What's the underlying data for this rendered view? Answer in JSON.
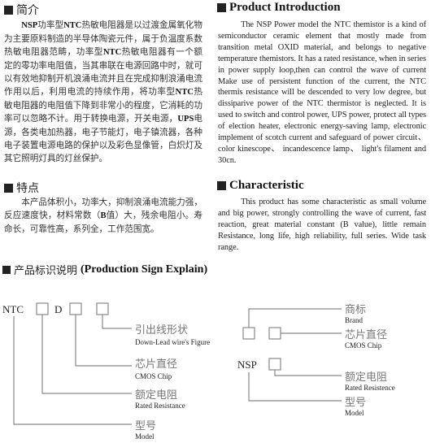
{
  "intro_cn": {
    "heading": "简介",
    "parts": [
      {
        "t": "NSP",
        "b": true
      },
      {
        "t": "功率型",
        "b": false
      },
      {
        "t": "NTC",
        "b": true
      },
      {
        "t": "热敏电阻器是以过渡金属氧化物为主要原料制造的半导体陶瓷元件，属于负温度系数热敏电阻器范畴，功率型",
        "b": false
      },
      {
        "t": "NTC",
        "b": true
      },
      {
        "t": "热敏电阻器有一个额定的零功率电阻值，当其串联在电源回路中时，就可以有效地抑制开机浪涌电流并且在完成抑制浪涌电流作用以后，利用电流的持续作用，将功率型",
        "b": false
      },
      {
        "t": "NTC",
        "b": true
      },
      {
        "t": "热敏电阻器的电阻值下降到非常小的程度，它消耗的功率可以忽略不计。用于转换电源，开关电源，",
        "b": false
      },
      {
        "t": "UPS",
        "b": true
      },
      {
        "t": "电源，各类电加热器，电子节能灯，电子镇流器，各种电子装置电源电路的保护以及彩色显像管，白炽灯及其它照明灯具的灯丝保护。",
        "b": false
      }
    ]
  },
  "intro_en": {
    "heading": "Product Introduction",
    "text": "The NSP Power model the NTC themistor is a kind of semiconductor ceramic element that mostly made from transition metal OXID material, and belongs to negative temperature themistors. It has a rated resistance, when in series in power supply loop,then can control the wave of current Make use of persistent function of the current, the NTC thermis resistance will be descended to very low degree, but dissiparive power of the NTC thermistor is neglected. It is used to switch and control power, UPS power, protect all types of election heater, electronic energy-saving lamp, electronic implement of scotch current and safeguard of power circuit、 color kinescope、 incandescence lamp、 light's filament and 30cn."
  },
  "features_cn": {
    "heading": "特点",
    "parts": [
      {
        "t": "本产品体积小，功率大，抑制浪涌电流能力强，反应速度快，材料常数（",
        "b": false
      },
      {
        "t": "B",
        "b": true
      },
      {
        "t": "值）大，残余电阻小。寿命长，可靠性高，系列全，工作范围宽。",
        "b": false
      }
    ]
  },
  "features_en": {
    "heading": "Characteristic",
    "text": "This product has some characteristic as small volume and big power, strongly controlling the wave of current, fast reaction, great material constant (B value), little remain Resistance, long life, high reliability, full series. Wide task range."
  },
  "sign_explain": {
    "heading_cn": "产品标识说明",
    "heading_en": "(Production Sign Explain)",
    "ntc": {
      "prefix": "NTC",
      "middle": "D",
      "labels": [
        {
          "cn": "引出线形状",
          "en": "Down-Lead wire's Figure"
        },
        {
          "cn": "芯片直径",
          "en": "CMOS Chip"
        },
        {
          "cn": "额定电阻",
          "en": "Rated Resistance"
        },
        {
          "cn": "型号",
          "en": "Model"
        }
      ]
    },
    "nsp": {
      "prefix": "NSP",
      "labels": [
        {
          "cn": "商标",
          "en": "Brand"
        },
        {
          "cn": "芯片直径",
          "en": "CMOS Chip"
        },
        {
          "cn": "额定电阻",
          "en": "Rated Resistence"
        },
        {
          "cn": "型号",
          "en": "Model"
        }
      ]
    }
  }
}
